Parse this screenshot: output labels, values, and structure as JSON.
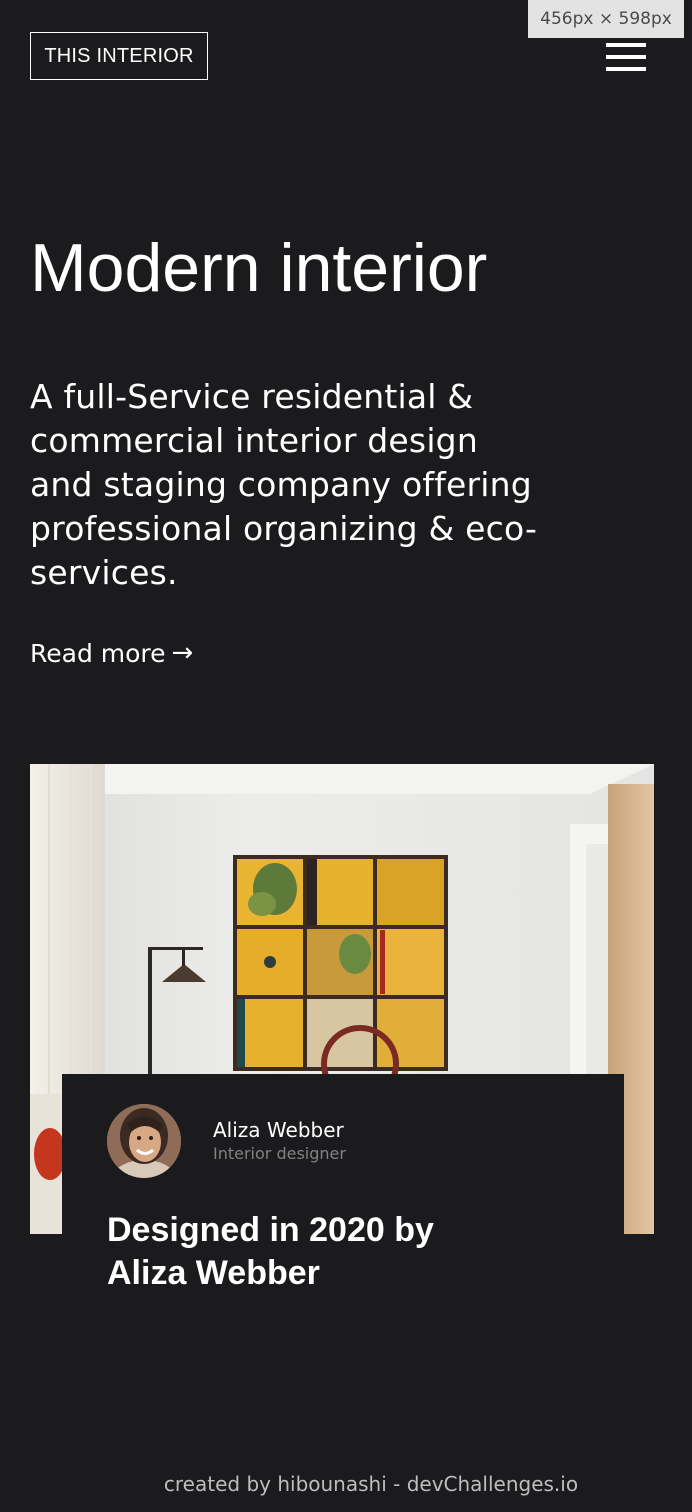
{
  "header": {
    "logo_text": "THIS INTERIOR",
    "menu_icon": "hamburger-menu-icon"
  },
  "viewport_badge": "456px × 598px",
  "hero": {
    "title": "Modern interior",
    "description": "A full-Service residential & commercial interior design and staging company offering professional organizing & eco-services.",
    "read_more_label": "Read more",
    "read_more_icon": "→"
  },
  "image": {
    "subject": "living room with yellow cabinet wall art and floor lamp"
  },
  "card": {
    "author_name": "Aliza Webber",
    "author_role": "Interior designer",
    "title": "Designed in 2020 by Aliza Webber"
  },
  "footer": {
    "credit": "created by hibounashi - devChallenges.io"
  },
  "colors": {
    "background": "#1b1a1d",
    "text": "#ffffff",
    "muted_text": "#828282",
    "footer_text": "#bdbdbd",
    "accent_yellow": "#e8b431"
  }
}
